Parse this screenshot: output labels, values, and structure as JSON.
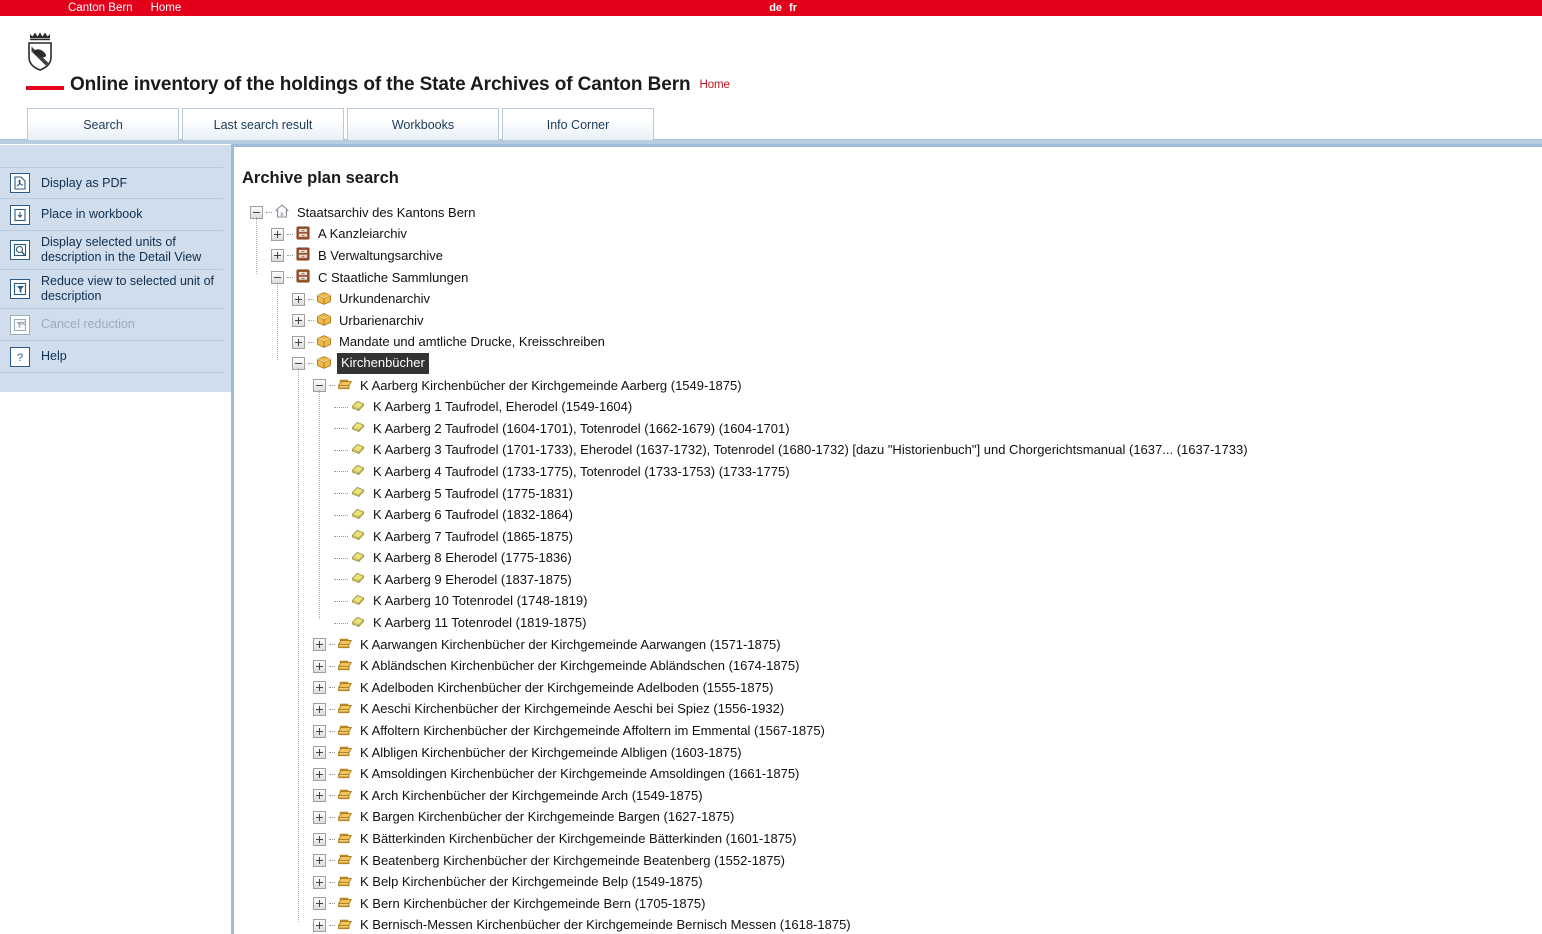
{
  "topbar": {
    "canton_link": "Canton Bern",
    "home_link": "Home",
    "lang_de": "de",
    "lang_fr": "fr",
    "bg_color": "#e2001a"
  },
  "header": {
    "crest_icon": "bern-coat-of-arms-icon",
    "title": "Online inventory of the holdings of the State Archives of Canton Bern",
    "home_link": "Home",
    "accent_color": "#e2001a"
  },
  "tabs": [
    {
      "label": "Search",
      "name": "tab-search"
    },
    {
      "label": "Last search result",
      "name": "tab-last-search-result"
    },
    {
      "label": "Workbooks",
      "name": "tab-workbooks"
    },
    {
      "label": "Info Corner",
      "name": "tab-info-corner"
    }
  ],
  "sidebar": {
    "items": [
      {
        "label": "Display as PDF",
        "icon": "pdf-icon",
        "disabled": false
      },
      {
        "label": "Place in workbook",
        "icon": "place-in-workbook-icon",
        "disabled": false
      },
      {
        "label": "Display selected units of description in the Detail View",
        "icon": "detail-view-icon",
        "disabled": false
      },
      {
        "label": "Reduce view to selected unit of description",
        "icon": "reduce-view-icon",
        "disabled": false
      },
      {
        "label": "Cancel reduction",
        "icon": "cancel-reduction-icon",
        "disabled": true
      },
      {
        "label": "Help",
        "icon": "help-icon",
        "disabled": false
      }
    ]
  },
  "main": {
    "page_title": "Archive plan search",
    "tree": [
      {
        "level": 0,
        "label": "Staatsarchiv des Kantons Bern",
        "icon": "home-icon",
        "state": "expanded",
        "selected": false
      },
      {
        "level": 1,
        "label": "A Kanzleiarchiv",
        "icon": "cabinet-icon",
        "state": "collapsed",
        "selected": false
      },
      {
        "level": 1,
        "label": "B Verwaltungsarchive",
        "icon": "cabinet-icon",
        "state": "collapsed",
        "selected": false
      },
      {
        "level": 1,
        "label": "C Staatliche Sammlungen",
        "icon": "cabinet-icon",
        "state": "expanded",
        "selected": false
      },
      {
        "level": 2,
        "label": "Urkundenarchiv",
        "icon": "box-icon",
        "state": "collapsed",
        "selected": false
      },
      {
        "level": 2,
        "label": "Urbarienarchiv",
        "icon": "box-icon",
        "state": "collapsed",
        "selected": false
      },
      {
        "level": 2,
        "label": "Mandate und amtliche Drucke, Kreisschreiben",
        "icon": "box-icon",
        "state": "collapsed",
        "selected": false
      },
      {
        "level": 2,
        "label": "Kirchenbücher",
        "icon": "box-icon",
        "state": "expanded",
        "selected": true
      },
      {
        "level": 3,
        "label": "K Aarberg Kirchenbücher der Kirchgemeinde Aarberg (1549-1875)",
        "icon": "folder-icon",
        "state": "expanded",
        "selected": false
      },
      {
        "level": 4,
        "label": "K Aarberg 1 Taufrodel, Eherodel (1549-1604)",
        "icon": "document-icon",
        "state": "leaf",
        "selected": false
      },
      {
        "level": 4,
        "label": "K Aarberg 2 Taufrodel (1604-1701), Totenrodel (1662-1679) (1604-1701)",
        "icon": "document-icon",
        "state": "leaf",
        "selected": false
      },
      {
        "level": 4,
        "label": "K Aarberg 3 Taufrodel (1701-1733), Eherodel (1637-1732), Totenrodel (1680-1732) [dazu \"Historienbuch\"] und Chorgerichtsmanual (1637... (1637-1733)",
        "icon": "document-icon",
        "state": "leaf",
        "selected": false
      },
      {
        "level": 4,
        "label": "K Aarberg 4 Taufrodel (1733-1775), Totenrodel (1733-1753) (1733-1775)",
        "icon": "document-icon",
        "state": "leaf",
        "selected": false
      },
      {
        "level": 4,
        "label": "K Aarberg 5 Taufrodel (1775-1831)",
        "icon": "document-icon",
        "state": "leaf",
        "selected": false
      },
      {
        "level": 4,
        "label": "K Aarberg 6 Taufrodel (1832-1864)",
        "icon": "document-icon",
        "state": "leaf",
        "selected": false
      },
      {
        "level": 4,
        "label": "K Aarberg 7 Taufrodel (1865-1875)",
        "icon": "document-icon",
        "state": "leaf",
        "selected": false
      },
      {
        "level": 4,
        "label": "K Aarberg 8 Eherodel (1775-1836)",
        "icon": "document-icon",
        "state": "leaf",
        "selected": false
      },
      {
        "level": 4,
        "label": "K Aarberg 9 Eherodel (1837-1875)",
        "icon": "document-icon",
        "state": "leaf",
        "selected": false
      },
      {
        "level": 4,
        "label": "K Aarberg 10 Totenrodel (1748-1819)",
        "icon": "document-icon",
        "state": "leaf",
        "selected": false
      },
      {
        "level": 4,
        "label": "K Aarberg 11 Totenrodel (1819-1875)",
        "icon": "document-icon",
        "state": "leaf",
        "selected": false
      },
      {
        "level": 3,
        "label": "K Aarwangen Kirchenbücher der Kirchgemeinde Aarwangen (1571-1875)",
        "icon": "folder-icon",
        "state": "collapsed",
        "selected": false
      },
      {
        "level": 3,
        "label": "K Abländschen Kirchenbücher der Kirchgemeinde Abländschen (1674-1875)",
        "icon": "folder-icon",
        "state": "collapsed",
        "selected": false
      },
      {
        "level": 3,
        "label": "K Adelboden Kirchenbücher der Kirchgemeinde Adelboden (1555-1875)",
        "icon": "folder-icon",
        "state": "collapsed",
        "selected": false
      },
      {
        "level": 3,
        "label": "K Aeschi Kirchenbücher der Kirchgemeinde Aeschi bei Spiez (1556-1932)",
        "icon": "folder-icon",
        "state": "collapsed",
        "selected": false
      },
      {
        "level": 3,
        "label": "K Affoltern Kirchenbücher der Kirchgemeinde Affoltern im Emmental (1567-1875)",
        "icon": "folder-icon",
        "state": "collapsed",
        "selected": false
      },
      {
        "level": 3,
        "label": "K Albligen Kirchenbücher der Kirchgemeinde Albligen (1603-1875)",
        "icon": "folder-icon",
        "state": "collapsed",
        "selected": false
      },
      {
        "level": 3,
        "label": "K Amsoldingen Kirchenbücher der Kirchgemeinde Amsoldingen (1661-1875)",
        "icon": "folder-icon",
        "state": "collapsed",
        "selected": false
      },
      {
        "level": 3,
        "label": "K Arch Kirchenbücher der Kirchgemeinde Arch (1549-1875)",
        "icon": "folder-icon",
        "state": "collapsed",
        "selected": false
      },
      {
        "level": 3,
        "label": "K Bargen Kirchenbücher der Kirchgemeinde Bargen (1627-1875)",
        "icon": "folder-icon",
        "state": "collapsed",
        "selected": false
      },
      {
        "level": 3,
        "label": "K Bätterkinden Kirchenbücher der Kirchgemeinde Bätterkinden (1601-1875)",
        "icon": "folder-icon",
        "state": "collapsed",
        "selected": false
      },
      {
        "level": 3,
        "label": "K Beatenberg Kirchenbücher der Kirchgemeinde Beatenberg (1552-1875)",
        "icon": "folder-icon",
        "state": "collapsed",
        "selected": false
      },
      {
        "level": 3,
        "label": "K Belp Kirchenbücher der Kirchgemeinde Belp (1549-1875)",
        "icon": "folder-icon",
        "state": "collapsed",
        "selected": false
      },
      {
        "level": 3,
        "label": "K Bern Kirchenbücher der Kirchgemeinde Bern (1705-1875)",
        "icon": "folder-icon",
        "state": "collapsed",
        "selected": false
      },
      {
        "level": 3,
        "label": "K Bernisch-Messen Kirchenbücher der Kirchgemeinde Bernisch Messen (1618-1875)",
        "icon": "folder-icon",
        "state": "collapsed",
        "selected": false
      }
    ]
  }
}
